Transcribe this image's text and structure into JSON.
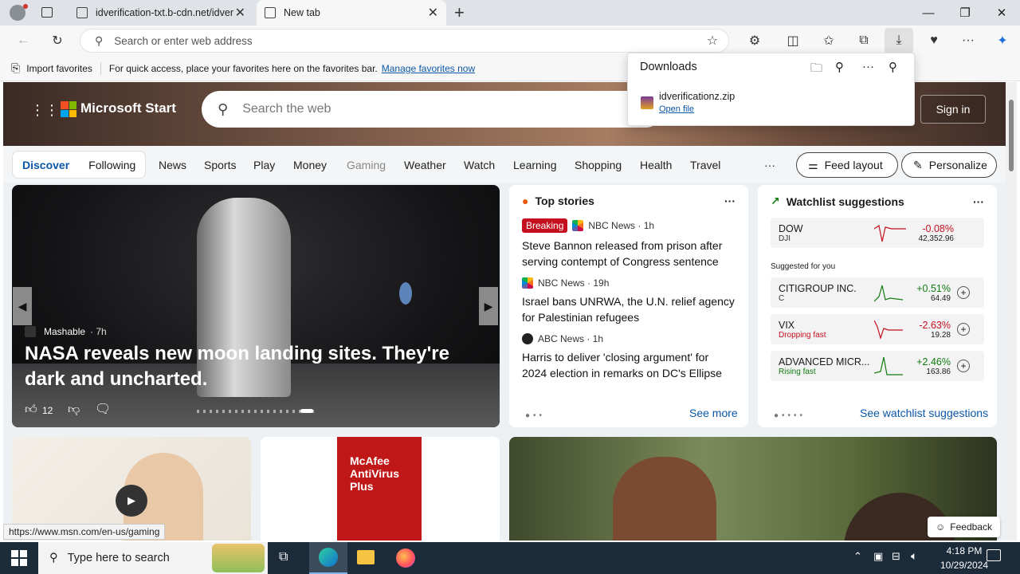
{
  "browser": {
    "tabs": [
      {
        "label": "idverification-txt.b-cdn.net/idver",
        "active": false
      },
      {
        "label": "New tab",
        "active": true
      }
    ],
    "new_tab_symbol": "+",
    "address_placeholder": "Search or enter web address"
  },
  "favorites_bar": {
    "import_label": "Import favorites",
    "hint": "For quick access, place your favorites here on the favorites bar.",
    "manage_link": "Manage favorites now"
  },
  "downloads": {
    "title": "Downloads",
    "file_name": "idverificationz.zip",
    "open_label": "Open file"
  },
  "msn": {
    "brand": "Microsoft Start",
    "search_placeholder": "Search the web",
    "sign_in": "Sign in",
    "pill_tabs": [
      "Discover",
      "Following"
    ],
    "nav": [
      "News",
      "Sports",
      "Play",
      "Money",
      "Gaming",
      "Weather",
      "Watch",
      "Learning",
      "Shopping",
      "Health",
      "Travel"
    ],
    "more": "···",
    "feed_layout": "Feed layout",
    "personalize": "Personalize"
  },
  "hero": {
    "source": "Mashable",
    "age": "· 7h",
    "title": "NASA reveals new moon landing sites. They're dark and uncharted.",
    "likes": "12"
  },
  "top_stories": {
    "title": "Top stories",
    "items": [
      {
        "badge": "Breaking",
        "source": "NBC News · 1h",
        "headline": "Steve Bannon released from prison after serving contempt of Congress sentence"
      },
      {
        "badge": "",
        "source": "NBC News · 19h",
        "headline": "Israel bans UNRWA, the U.N. relief agency for Palestinian refugees"
      },
      {
        "badge": "",
        "source": "ABC News · 1h",
        "headline": "Harris to deliver 'closing argument' for 2024 election in remarks on DC's Ellipse"
      }
    ],
    "see_more": "See more"
  },
  "watchlist": {
    "title": "Watchlist suggestions",
    "main": {
      "name": "DOW",
      "sub": "DJI",
      "change": "-0.08%",
      "price": "42,352.96",
      "color": "#c50f1f"
    },
    "suggested_label": "Suggested for you",
    "items": [
      {
        "name": "CITIGROUP INC.",
        "sub": "C",
        "change": "+0.51%",
        "price": "64.49",
        "color": "#107c10"
      },
      {
        "name": "VIX",
        "sub": "Dropping fast",
        "change": "-2.63%",
        "price": "19.28",
        "color": "#c50f1f"
      },
      {
        "name": "ADVANCED MICR...",
        "sub": "Rising fast",
        "change": "+2.46%",
        "price": "163.86",
        "color": "#107c10"
      }
    ],
    "see_link": "See watchlist suggestions"
  },
  "status_url": "https://www.msn.com/en-us/gaming",
  "feedback": "Feedback",
  "mcafee": "McAfee AntiVirus Plus",
  "taskbar": {
    "search_placeholder": "Type here to search",
    "time": "4:18 PM",
    "date": "10/29/2024"
  }
}
